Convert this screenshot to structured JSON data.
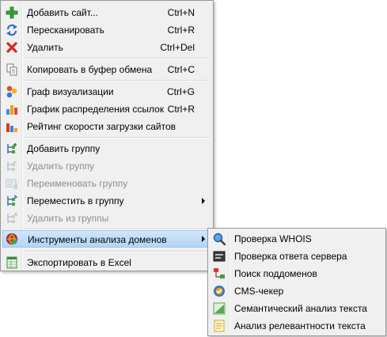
{
  "main_menu": {
    "items": [
      {
        "label": "Добавить сайт...",
        "shortcut": "Ctrl+N",
        "icon": "add-plus-icon"
      },
      {
        "label": "Пересканировать",
        "shortcut": "Ctrl+R",
        "icon": "refresh-icon"
      },
      {
        "label": "Удалить",
        "shortcut": "Ctrl+Del",
        "icon": "delete-x-icon"
      },
      {
        "label": "Копировать в буфер обмена",
        "shortcut": "Ctrl+C",
        "icon": "copy-icon"
      },
      {
        "label": "Граф визуализации",
        "shortcut": "Ctrl+G",
        "icon": "graph-icon"
      },
      {
        "label": "График распределения ссылок",
        "shortcut": "Ctrl+R",
        "icon": "bar-chart-icon"
      },
      {
        "label": "Рейтинг скорости загрузки сайтов",
        "shortcut": "",
        "icon": "speed-rating-icon"
      },
      {
        "label": "Добавить группу",
        "shortcut": "",
        "icon": "add-group-icon"
      },
      {
        "label": "Удалить группу",
        "shortcut": "",
        "icon": "remove-group-icon",
        "disabled": true
      },
      {
        "label": "Переименовать группу",
        "shortcut": "",
        "icon": "rename-group-icon",
        "disabled": true
      },
      {
        "label": "Переместить в группу",
        "shortcut": "",
        "icon": "move-to-group-icon"
      },
      {
        "label": "Удалить из группы",
        "shortcut": "",
        "icon": "remove-from-group-icon",
        "disabled": true
      },
      {
        "label": "Инструменты анализа доменов",
        "shortcut": "",
        "icon": "domain-tools-icon"
      },
      {
        "label": "Экспортировать в Excel",
        "shortcut": "",
        "icon": "excel-icon"
      }
    ]
  },
  "sub_menu": {
    "items": [
      {
        "label": "Проверка WHOIS",
        "icon": "whois-search-icon"
      },
      {
        "label": "Проверка ответа сервера",
        "icon": "server-response-icon"
      },
      {
        "label": "Поиск поддоменов",
        "icon": "subdomain-icon"
      },
      {
        "label": "CMS-чекер",
        "icon": "cms-checker-icon"
      },
      {
        "label": "Семантический анализ текста",
        "icon": "semantic-analysis-icon"
      },
      {
        "label": "Анализ релевантности текста",
        "icon": "relevance-analysis-icon"
      }
    ]
  },
  "colors": {
    "menu_bg": "#f0f0f0",
    "highlight": "#b3d5f5",
    "disabled_text": "#8d8d8d"
  }
}
